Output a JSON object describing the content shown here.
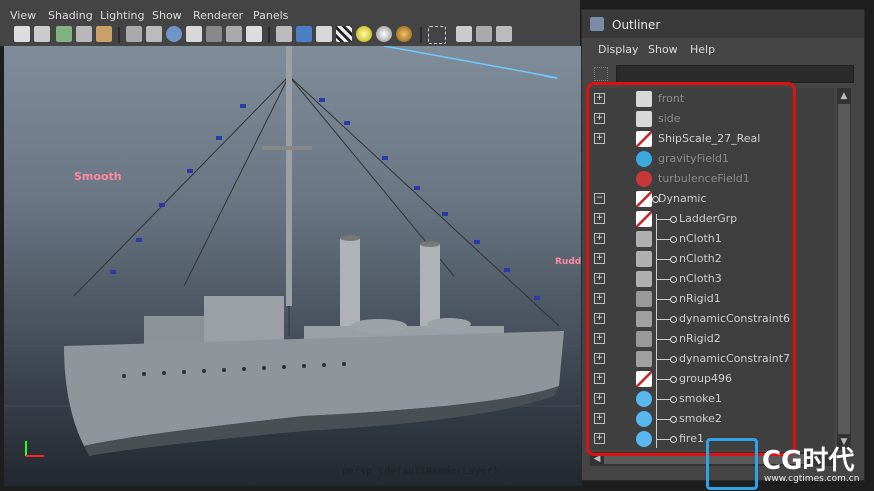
{
  "menubar": {
    "items": [
      "View",
      "Shading",
      "Lighting",
      "Show",
      "Renderer",
      "Panels"
    ]
  },
  "viewport": {
    "label": "persp (defaultRenderLayer)",
    "annotations": [
      "Smooth",
      "Rudder"
    ]
  },
  "outliner": {
    "title": "Outliner",
    "menu": [
      "Display",
      "Show",
      "Help"
    ],
    "items": [
      {
        "label": "front",
        "dim": true,
        "icon": "camera-icon"
      },
      {
        "label": "side",
        "dim": true,
        "icon": "camera-icon"
      },
      {
        "label": "ShipScale_27_Real",
        "dim": false,
        "icon": "transform-icon"
      },
      {
        "label": "gravityField1",
        "dim": true,
        "icon": "gravity-field-icon"
      },
      {
        "label": "turbulenceField1",
        "dim": true,
        "icon": "turbulence-field-icon"
      },
      {
        "label": "Dynamic",
        "dim": false,
        "icon": "transform-icon"
      },
      {
        "label": "LadderGrp",
        "dim": false,
        "icon": "transform-icon"
      },
      {
        "label": "nCloth1",
        "dim": false,
        "icon": "ncloth-icon"
      },
      {
        "label": "nCloth2",
        "dim": false,
        "icon": "ncloth-icon"
      },
      {
        "label": "nCloth3",
        "dim": false,
        "icon": "ncloth-icon"
      },
      {
        "label": "nRigid1",
        "dim": false,
        "icon": "nrigid-icon"
      },
      {
        "label": "dynamicConstraint6",
        "dim": false,
        "icon": "constraint-icon"
      },
      {
        "label": "nRigid2",
        "dim": false,
        "icon": "nrigid-icon"
      },
      {
        "label": "dynamicConstraint7",
        "dim": false,
        "icon": "constraint-icon"
      },
      {
        "label": "group496",
        "dim": false,
        "icon": "transform-icon"
      },
      {
        "label": "smoke1",
        "dim": false,
        "icon": "smoke-icon"
      },
      {
        "label": "smoke2",
        "dim": false,
        "icon": "smoke-icon"
      },
      {
        "label": "fire1",
        "dim": false,
        "icon": "fire-icon"
      }
    ]
  },
  "watermark": {
    "brand": "CG时代",
    "url": "www.cgtimes.com.cn"
  }
}
